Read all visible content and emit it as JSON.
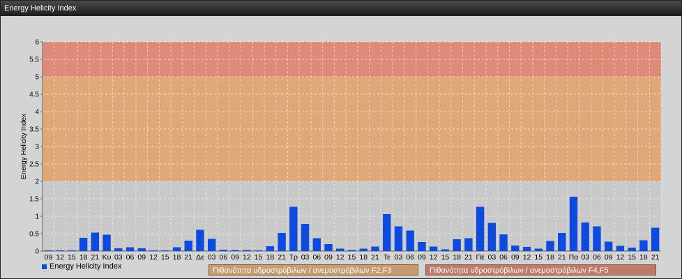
{
  "window": {
    "title": "Energy Helicity Index"
  },
  "legend": {
    "series_label": "Energy Helicity Index"
  },
  "zones": [
    {
      "label": "Πιθανότητα υδροστρόβιλων / ανεμοστρόβιλων F2,F3",
      "color": "#c79a70"
    },
    {
      "label": "Πιθανότητα υδροστρόβιλων / ανεμοστρόβιλων F4,F5",
      "color": "#c07a6a"
    }
  ],
  "chart_data": {
    "type": "bar",
    "ylabel": "Energy Helicity Index",
    "ylim": [
      0,
      6
    ],
    "yticks": [
      "0",
      "0.5",
      "1",
      "1.5",
      "2",
      "2.5",
      "3",
      "3.5",
      "4",
      "4.5",
      "5",
      "5.5",
      "6"
    ],
    "bands": [
      {
        "from": 0,
        "to": 2,
        "color": "#c9c9c9"
      },
      {
        "from": 2,
        "to": 5,
        "color": "#e0a878"
      },
      {
        "from": 5,
        "to": 6,
        "color": "#de8a78"
      }
    ],
    "grid": true,
    "bar_color": "#0d4be0",
    "categories": [
      "09",
      "12",
      "15",
      "18",
      "21",
      "Κυ",
      "03",
      "06",
      "09",
      "12",
      "15",
      "18",
      "21",
      "Δε",
      "03",
      "06",
      "09",
      "12",
      "15",
      "18",
      "21",
      "Τρ",
      "03",
      "06",
      "09",
      "12",
      "15",
      "18",
      "21",
      "Τε",
      "03",
      "06",
      "09",
      "12",
      "15",
      "18",
      "21",
      "Πέ",
      "03",
      "06",
      "09",
      "12",
      "15",
      "18",
      "21",
      "Πα",
      "03",
      "06",
      "09",
      "12",
      "15",
      "18",
      "21"
    ],
    "series": [
      {
        "name": "Energy Helicity Index",
        "values": [
          0.02,
          0.02,
          0.02,
          0.38,
          0.53,
          0.47,
          0.08,
          0.11,
          0.08,
          0.02,
          0.02,
          0.11,
          0.3,
          0.61,
          0.35,
          0.04,
          0.03,
          0.03,
          0.02,
          0.14,
          0.52,
          1.27,
          0.78,
          0.37,
          0.2,
          0.07,
          0.03,
          0.07,
          0.13,
          1.06,
          0.71,
          0.59,
          0.26,
          0.13,
          0.05,
          0.34,
          0.37,
          1.27,
          0.81,
          0.48,
          0.16,
          0.12,
          0.07,
          0.29,
          0.52,
          1.56,
          0.82,
          0.71,
          0.27,
          0.15,
          0.1,
          0.31,
          0.67
        ]
      }
    ]
  }
}
